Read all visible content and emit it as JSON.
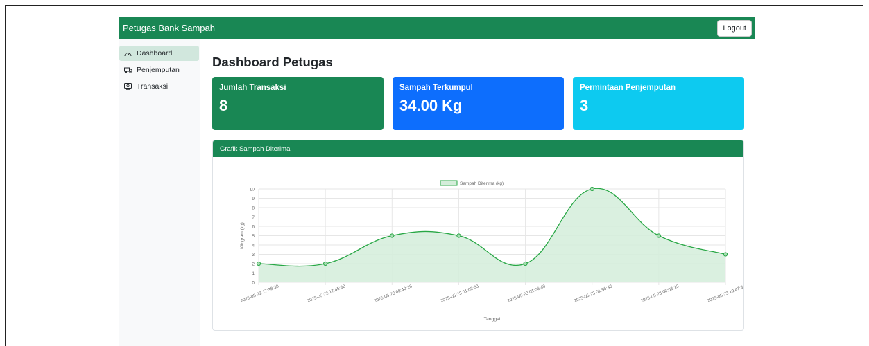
{
  "app": {
    "brand": "Petugas Bank Sampah",
    "logout_label": "Logout"
  },
  "sidebar": {
    "items": [
      {
        "label": "Dashboard",
        "icon": "speedometer-icon",
        "active": true
      },
      {
        "label": "Penjemputan",
        "icon": "truck-icon",
        "active": false
      },
      {
        "label": "Transaksi",
        "icon": "receipt-icon",
        "active": false
      }
    ]
  },
  "main": {
    "title": "Dashboard Petugas",
    "cards": [
      {
        "label": "Jumlah Transaksi",
        "value": "8",
        "color": "#198754"
      },
      {
        "label": "Sampah Terkumpul",
        "value": "34.00 Kg",
        "color": "#0d6efd"
      },
      {
        "label": "Permintaan Penjemputan",
        "value": "3",
        "color": "#0dcaf0"
      }
    ],
    "chart_title": "Grafik Sampah Diterima"
  },
  "colors": {
    "primary_green": "#198754",
    "line": "#28a745",
    "fill": "#d4edda"
  },
  "chart_data": {
    "type": "area",
    "legend": "Sampah Diterima (kg)",
    "legend_position": "top",
    "xlabel": "Tanggal",
    "ylabel": "Kilogram (kg)",
    "ylim": [
      0,
      10
    ],
    "yticks": [
      0,
      1,
      2,
      3,
      4,
      5,
      6,
      7,
      8,
      9,
      10
    ],
    "grid": true,
    "x": [
      "2025-05-22 17:38:38",
      "2025-05-22 17:45:38",
      "2025-05-23 00:40:26",
      "2025-05-23 01:03:53",
      "2025-05-23 01:06:40",
      "2025-05-23 01:56:43",
      "2025-05-23 08:03:15",
      "2025-05-23 10:47:38"
    ],
    "series": [
      {
        "name": "Sampah Diterima (kg)",
        "values": [
          2,
          2,
          5,
          5,
          2,
          10,
          5,
          3
        ]
      }
    ]
  }
}
